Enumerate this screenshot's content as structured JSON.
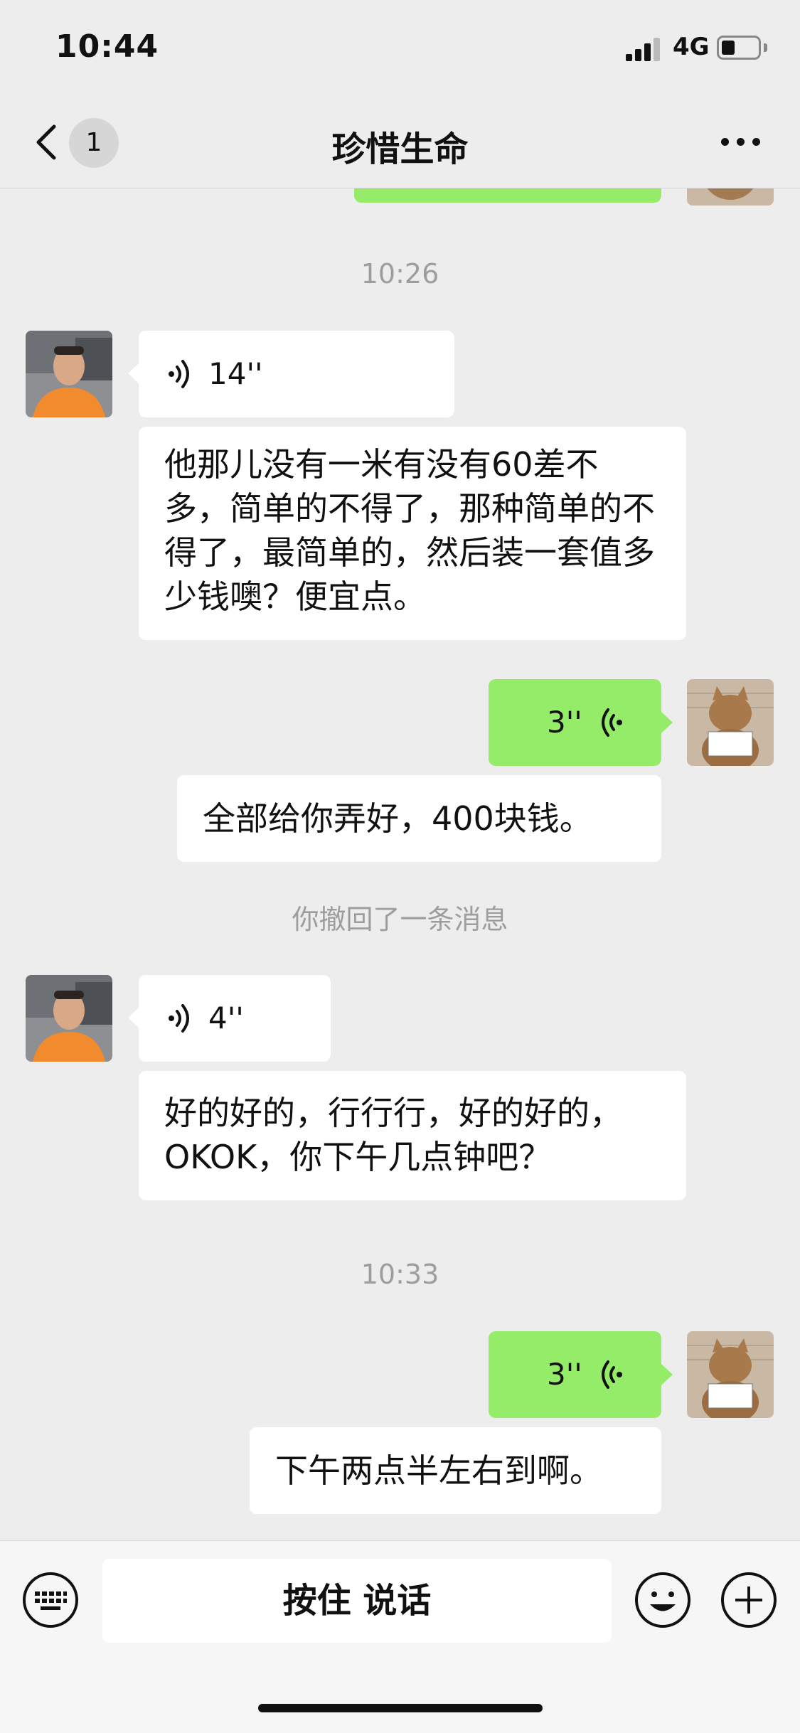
{
  "status_bar": {
    "time": "10:44",
    "network": "4G"
  },
  "nav": {
    "unread_count": "1",
    "title": "珍惜生命"
  },
  "messages": {
    "ts1": "10:26",
    "m1_voice_duration": "14''",
    "m2_text": "他那儿没有一米有没有60差不多，简单的不得了，那种简单的不得了，最简单的，然后装一套值多少钱噢？便宜点。",
    "m3_voice_duration": "3''",
    "m4_text": "全部给你弄好，400块钱。",
    "recall": "你撤回了一条消息",
    "m5_voice_duration": "4''",
    "m6_text": "好的好的，行行行，好的好的，OKOK，你下午几点钟吧？",
    "ts2": "10:33",
    "m7_voice_duration": "3''",
    "m8_text": "下午两点半左右到啊。"
  },
  "avatars": {
    "contact": "man-orange-shirt-photo",
    "self": "cat-holding-sign-photo"
  },
  "input_bar": {
    "hold_to_talk": "按住 说话"
  },
  "colors": {
    "background": "#ededed",
    "sent_bubble": "#95ec69",
    "received_bubble": "#ffffff",
    "meta_text": "#9d9d9d"
  },
  "icons": [
    "back-chevron",
    "more-dots",
    "voice-wave",
    "keyboard",
    "emoji-face",
    "plus-circle"
  ]
}
